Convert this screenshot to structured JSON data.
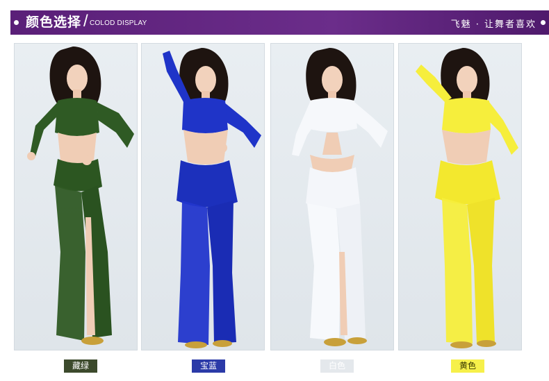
{
  "header": {
    "title": "颜色选择",
    "slash": "/",
    "subtitle": "COLOD DISPLAY",
    "slogan": "飞魅 · 让舞者喜欢"
  },
  "colors": {
    "header_bg": "#5a1f78",
    "panel_bg": "#e6ebef"
  },
  "variants": [
    {
      "label": "藏绿",
      "color": "#2f5a24"
    },
    {
      "label": "宝蓝",
      "color": "#1f34c8"
    },
    {
      "label": "白色",
      "color": "#f4f6fa"
    },
    {
      "label": "黄色",
      "color": "#f6ee3c"
    }
  ]
}
